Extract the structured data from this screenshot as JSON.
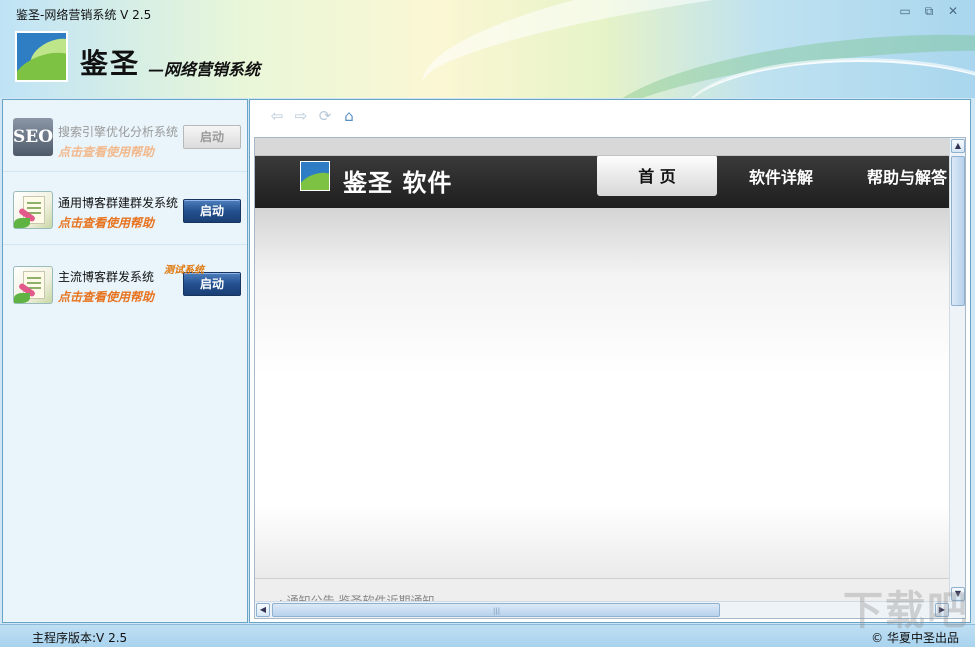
{
  "window": {
    "title": "鉴圣-网络营销系统 V 2.5",
    "minimize_glyph": "▭",
    "restore_glyph": "⧉",
    "close_glyph": "✕"
  },
  "banner": {
    "brand_main": "鉴圣",
    "brand_sub": "—网络营销系统"
  },
  "tools": [
    {
      "name": "搜索引擎优化分析系统",
      "help": "点击查看使用帮助",
      "button": "启动",
      "enabled": false,
      "icon": "seo-icon",
      "icon_text": "SEO"
    },
    {
      "name": "通用博客群建群发系统",
      "help": "点击查看使用帮助",
      "button": "启动",
      "enabled": true,
      "icon": "blog-icon"
    },
    {
      "name": "主流博客群发系统",
      "help": "点击查看使用帮助",
      "button": "启动",
      "enabled": true,
      "icon": "blog-icon",
      "tag": "测试系统"
    }
  ],
  "nav": {
    "back": "⇦",
    "forward": "⇨",
    "refresh": "⟳",
    "home": "⌂"
  },
  "site": {
    "name": "鉴圣 软件",
    "tabs": [
      "首 页",
      "软件详解",
      "帮助与解答"
    ],
    "active_tab": 0,
    "notice": "· 通知公告   鉴圣软件近期通知"
  },
  "statusbar": {
    "version": "主程序版本:V 2.5",
    "copyright": "© 华夏中圣出品"
  },
  "watermark": "下载吧",
  "colors": {
    "accent_orange": "#e8731f",
    "button_blue": "#23508f",
    "panel_border": "#6aa3c8"
  }
}
